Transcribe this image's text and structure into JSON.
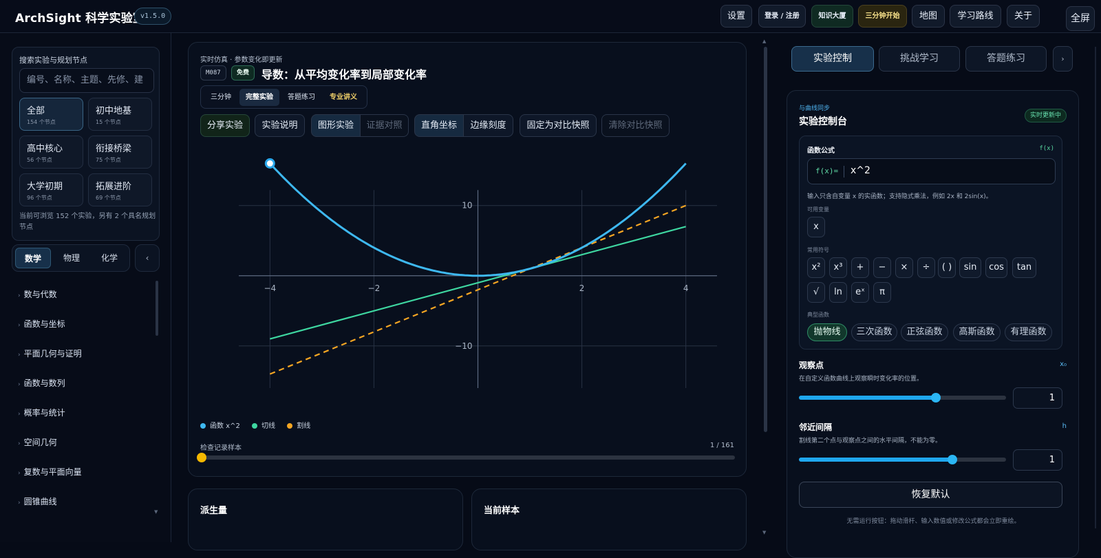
{
  "app": {
    "title": "ArchSight 科学实验室",
    "version": "v1.5.0"
  },
  "topnav": [
    "设置",
    "登录 / 注册",
    "知识大厦",
    "三分钟开始",
    "地图",
    "学习路线",
    "关于",
    "全屏"
  ],
  "sidebar": {
    "search_title": "搜索实验与规划节点",
    "search_placeholder": "编号、名称、主题、先修、建",
    "categories": [
      {
        "name": "全部",
        "count": "154 个节点"
      },
      {
        "name": "初中地基",
        "count": "15 个节点"
      },
      {
        "name": "高中核心",
        "count": "56 个节点"
      },
      {
        "name": "衔接桥梁",
        "count": "75 个节点"
      },
      {
        "name": "大学初期",
        "count": "96 个节点"
      },
      {
        "name": "拓展进阶",
        "count": "69 个节点"
      }
    ],
    "browse_note": "当前可浏览 152 个实验，另有 2 个具名规划节点",
    "subjects": [
      "数学",
      "物理",
      "化学"
    ],
    "collapse": "‹",
    "topics": [
      "数与代数",
      "函数与坐标",
      "平面几何与证明",
      "函数与数列",
      "概率与统计",
      "空间几何",
      "复数与平面向量",
      "圆锥曲线"
    ]
  },
  "experiment": {
    "live_line": "实时仿真 · 参数变化即更新",
    "code": "M087",
    "free_badge": "免费",
    "title": "导数：从平均变化率到局部变化率",
    "modes": [
      "三分钟",
      "完整实验",
      "答题练习",
      "专业讲义"
    ],
    "tools": [
      "分享实验",
      "实验说明",
      "图形实验",
      "证据对照",
      "直角坐标",
      "边缘刻度",
      "固定为对比快照",
      "清除对比快照"
    ],
    "legend": [
      "函数 x^2",
      "切线",
      "割线"
    ],
    "legend_colors": [
      "#3eb8f0",
      "#3ed6a0",
      "#f5a623"
    ],
    "sample_label": "检查记录样本",
    "sample_count": "1 / 161",
    "sample_position": 0
  },
  "chart_data": {
    "type": "line",
    "x_ticks": [
      "−4",
      "−2",
      "2",
      "4"
    ],
    "y_ticks": [
      "10",
      "−10"
    ],
    "xlim": [
      -4.6,
      4.6
    ],
    "ylim": [
      -16,
      18.5
    ],
    "grid": true,
    "series": [
      {
        "name": "函数 x^2",
        "color": "#3eb8f0",
        "x": [
          -4,
          -3.5,
          -3,
          -2.5,
          -2,
          -1.5,
          -1,
          -0.5,
          0,
          0.5,
          1,
          1.5,
          2,
          2.5,
          3,
          3.5,
          4
        ],
        "y": [
          16,
          12.25,
          9,
          6.25,
          4,
          2.25,
          1,
          0.25,
          0,
          0.25,
          1,
          2.25,
          4,
          6.25,
          9,
          12.25,
          16
        ]
      },
      {
        "name": "切线",
        "color": "#3ed6a0",
        "x": [
          -4,
          4
        ],
        "y": [
          -9,
          7
        ]
      },
      {
        "name": "割线",
        "color": "#f5a623",
        "x": [
          -4,
          4
        ],
        "y": [
          -14,
          10
        ]
      }
    ],
    "marker": {
      "x": -4,
      "y": 16
    }
  },
  "bottom_cards": [
    "派生量",
    "当前样本"
  ],
  "right": {
    "tabs": [
      "实验控制",
      "挑战学习",
      "答题练习",
      "›"
    ],
    "sync": "与曲线同步",
    "title": "实验控制台",
    "live_badge": "实时更新中",
    "formula": {
      "title": "函数公式",
      "tag": "f(x)",
      "prefix": "f(x)=",
      "value": "x^2",
      "hint": "输入只含自变量 x 的实函数；支持隐式乘法，例如 2x 和 2sin(x)。",
      "vars_label": "可用变量",
      "vars": [
        "x"
      ],
      "symbols_label": "常用符号",
      "symbols": [
        "x²",
        "x³",
        "+",
        "−",
        "×",
        "÷",
        "( )",
        "sin",
        "cos",
        "tan",
        "√",
        "ln",
        "eˣ",
        "π"
      ],
      "presets_label": "典型函数",
      "presets": [
        "抛物线",
        "三次函数",
        "正弦函数",
        "高斯函数",
        "有理函数"
      ]
    },
    "params": [
      {
        "title": "观察点",
        "sym": "x₀",
        "desc": "在自定义函数曲线上观察瞬时变化率的位置。",
        "value": "1",
        "level": 0.66
      },
      {
        "title": "邻近间隔",
        "sym": "h",
        "desc": "割线第二个点与观察点之间的水平间隔，不能为零。",
        "value": "1",
        "level": 0.74
      }
    ],
    "reset": "恢复默认",
    "footnote": "无需运行按钮：拖动滑杆、输入数值或修改公式都会立即重绘。"
  }
}
